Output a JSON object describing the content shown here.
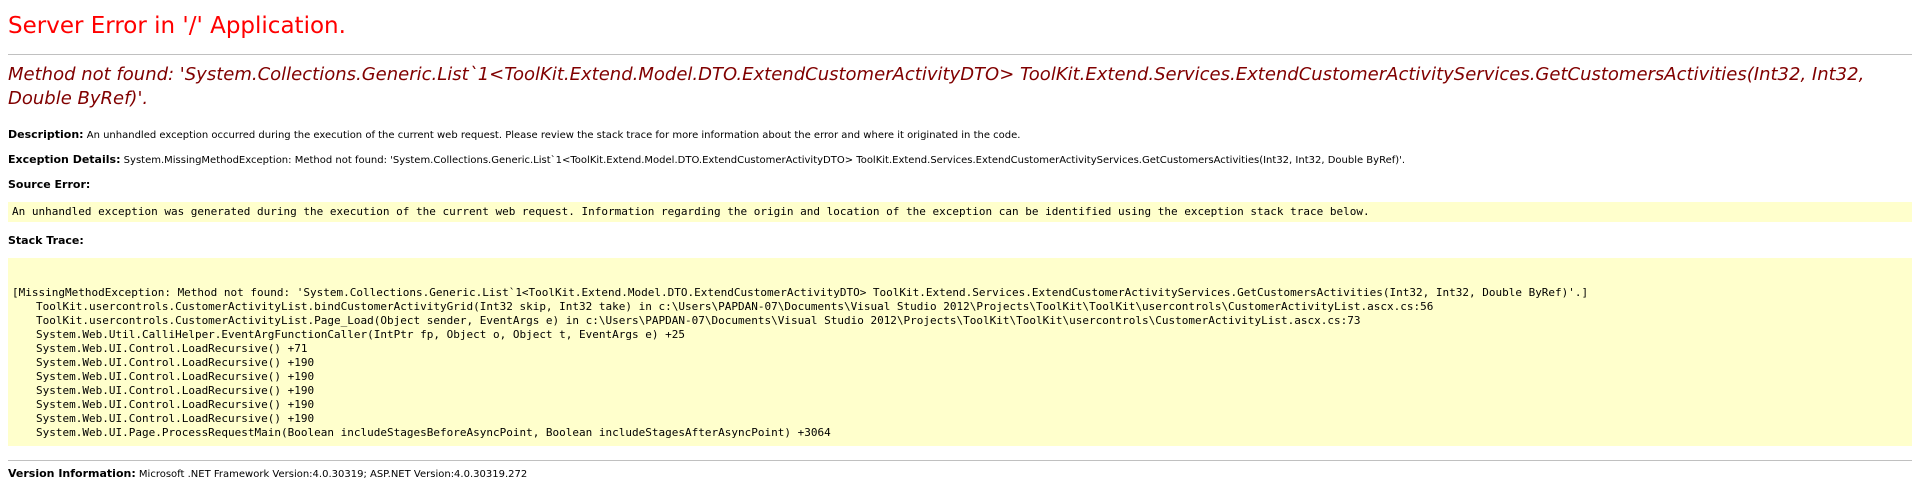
{
  "header": {
    "title": "Server Error in '/' Application.",
    "error_message": "Method not found: 'System.Collections.Generic.List`1<ToolKit.Extend.Model.DTO.ExtendCustomerActivityDTO> ToolKit.Extend.Services.ExtendCustomerActivityServices.GetCustomersActivities(Int32, Int32, Double ByRef)'."
  },
  "description": {
    "label": "Description:",
    "text": "An unhandled exception occurred during the execution of the current web request. Please review the stack trace for more information about the error and where it originated in the code."
  },
  "exception_details": {
    "label": "Exception Details:",
    "text": "System.MissingMethodException: Method not found: 'System.Collections.Generic.List`1<ToolKit.Extend.Model.DTO.ExtendCustomerActivityDTO> ToolKit.Extend.Services.ExtendCustomerActivityServices.GetCustomersActivities(Int32, Int32, Double ByRef)'."
  },
  "source_error": {
    "label": "Source Error:",
    "text": "An unhandled exception was generated during the execution of the current web request. Information regarding the origin and location of the exception can be identified using the exception stack trace below."
  },
  "stack_trace": {
    "label": "Stack Trace:",
    "lines": [
      "[MissingMethodException: Method not found: 'System.Collections.Generic.List`1<ToolKit.Extend.Model.DTO.ExtendCustomerActivityDTO> ToolKit.Extend.Services.ExtendCustomerActivityServices.GetCustomersActivities(Int32, Int32, Double ByRef)'.]",
      "ToolKit.usercontrols.CustomerActivityList.bindCustomerActivityGrid(Int32 skip, Int32 take) in c:\\Users\\PAPDAN-07\\Documents\\Visual Studio 2012\\Projects\\ToolKit\\ToolKit\\usercontrols\\CustomerActivityList.ascx.cs:56",
      "ToolKit.usercontrols.CustomerActivityList.Page_Load(Object sender, EventArgs e) in c:\\Users\\PAPDAN-07\\Documents\\Visual Studio 2012\\Projects\\ToolKit\\ToolKit\\usercontrols\\CustomerActivityList.ascx.cs:73",
      "System.Web.Util.CalliHelper.EventArgFunctionCaller(IntPtr fp, Object o, Object t, EventArgs e) +25",
      "System.Web.UI.Control.LoadRecursive() +71",
      "System.Web.UI.Control.LoadRecursive() +190",
      "System.Web.UI.Control.LoadRecursive() +190",
      "System.Web.UI.Control.LoadRecursive() +190",
      "System.Web.UI.Control.LoadRecursive() +190",
      "System.Web.UI.Control.LoadRecursive() +190",
      "System.Web.UI.Page.ProcessRequestMain(Boolean includeStagesBeforeAsyncPoint, Boolean includeStagesAfterAsyncPoint) +3064"
    ]
  },
  "version_info": {
    "label": "Version Information:",
    "text": "Microsoft .NET Framework Version:4.0.30319; ASP.NET Version:4.0.30319.272"
  },
  "colors": {
    "title": "#ff0000",
    "error_message": "#800000",
    "code_background": "#ffffcc",
    "rule": "#c0c0c0"
  }
}
